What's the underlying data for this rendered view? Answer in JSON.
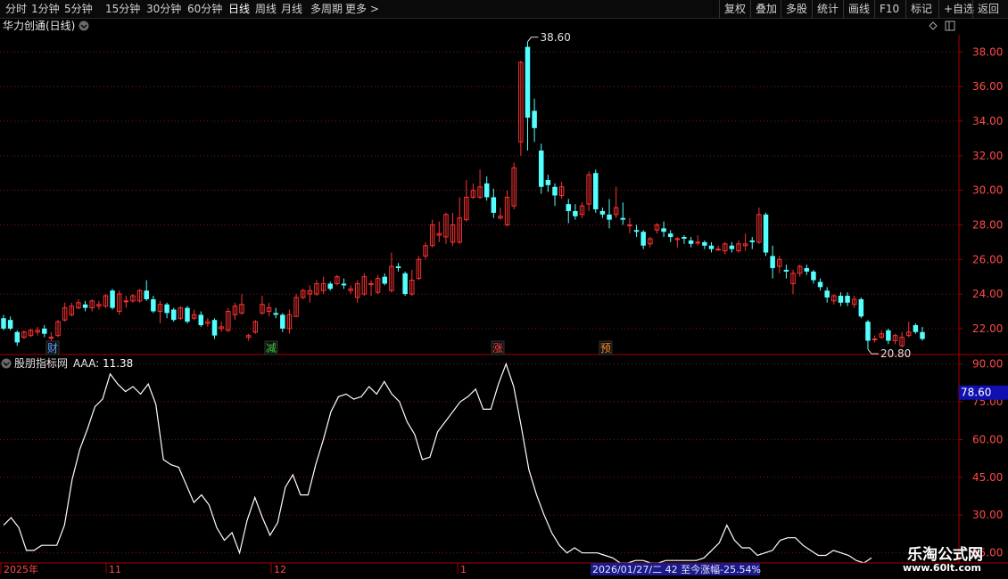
{
  "toolbar": {
    "periods": [
      "分时",
      "1分钟",
      "5分钟",
      "15分钟",
      "30分钟",
      "60分钟",
      "日线",
      "周线",
      "月线",
      "多周期",
      "更多 >"
    ],
    "active_period": "日线",
    "tools": [
      "复权",
      "叠加",
      "多股",
      "统计",
      "画线",
      "F10",
      "标记",
      "+自选",
      "返回"
    ]
  },
  "main_panel": {
    "title": "华力创通(日线)",
    "high_label": "38.60",
    "low_label": "20.80",
    "markers": [
      {
        "text": "财",
        "color": "#5aa0ff"
      },
      {
        "text": "减",
        "color": "#3ccc3c"
      },
      {
        "text": "涨",
        "color": "#ff4040"
      },
      {
        "text": "预",
        "color": "#ff8a28"
      }
    ]
  },
  "indicator_panel": {
    "title": "股朋指标网",
    "value_label": "AAA: 11.38",
    "current_value_badge": "78.60"
  },
  "status_bar": {
    "dates": [
      "2025年",
      "11",
      "12",
      "1"
    ],
    "range_info": "2026/01/27/二 42 至今涨幅-25.54%"
  },
  "watermark": {
    "text": "乐淘公式网",
    "url": "www.60lt.com"
  },
  "colors": {
    "up": "#ff3232",
    "down": "#54ffff",
    "grid": "#7a1a1a",
    "axis": "#aa0000",
    "line": "#ffffff"
  },
  "chart_data": [
    {
      "type": "candlestick",
      "ylim": [
        20.5,
        39.0
      ],
      "yticks": [
        "22.00",
        "24.00",
        "26.00",
        "28.00",
        "30.00",
        "32.00",
        "34.00",
        "36.00",
        "38.00"
      ],
      "candles": [
        [
          22.6,
          22.0,
          22.8,
          21.9
        ],
        [
          22.5,
          22.0,
          22.7,
          21.9
        ],
        [
          21.8,
          21.2,
          21.9,
          21.0
        ],
        [
          21.5,
          21.8,
          21.9,
          21.4
        ],
        [
          21.6,
          21.9,
          22.0,
          21.5
        ],
        [
          21.8,
          21.9,
          22.1,
          21.6
        ],
        [
          22.0,
          21.7,
          22.2,
          21.5
        ],
        [
          21.5,
          21.5,
          21.8,
          21.3
        ],
        [
          21.6,
          22.4,
          22.5,
          21.5
        ],
        [
          22.5,
          23.2,
          23.5,
          22.4
        ],
        [
          22.8,
          23.3,
          23.5,
          22.7
        ],
        [
          23.2,
          23.5,
          23.7,
          23.1
        ],
        [
          23.4,
          23.2,
          23.6,
          23.0
        ],
        [
          23.2,
          23.6,
          23.7,
          23.0
        ],
        [
          23.3,
          23.4,
          23.6,
          23.1
        ],
        [
          23.3,
          23.9,
          24.0,
          23.2
        ],
        [
          24.2,
          23.2,
          24.3,
          23.1
        ],
        [
          23.0,
          24.0,
          24.2,
          22.8
        ],
        [
          23.6,
          23.6,
          23.9,
          23.2
        ],
        [
          23.6,
          23.9,
          24.0,
          23.5
        ],
        [
          23.6,
          24.2,
          24.3,
          23.5
        ],
        [
          24.2,
          23.7,
          24.8,
          23.6
        ],
        [
          23.7,
          23.0,
          23.9,
          22.9
        ],
        [
          23.0,
          23.4,
          23.6,
          22.3
        ],
        [
          23.4,
          22.9,
          23.5,
          22.6
        ],
        [
          23.1,
          22.5,
          23.2,
          22.4
        ],
        [
          22.6,
          23.2,
          23.3,
          22.5
        ],
        [
          23.2,
          22.4,
          23.3,
          22.3
        ],
        [
          22.6,
          22.8,
          23.1,
          22.5
        ],
        [
          22.8,
          22.2,
          23.0,
          22.1
        ],
        [
          22.3,
          22.4,
          22.6,
          22.1
        ],
        [
          22.5,
          21.6,
          22.6,
          21.4
        ],
        [
          22.0,
          22.1,
          22.4,
          21.8
        ],
        [
          21.9,
          23.0,
          23.2,
          21.8
        ],
        [
          22.8,
          23.3,
          23.5,
          22.5
        ],
        [
          22.9,
          23.4,
          24.0,
          22.8
        ],
        [
          21.5,
          21.6,
          21.7,
          21.3
        ],
        [
          21.8,
          22.4,
          22.5,
          21.7
        ],
        [
          22.9,
          23.4,
          23.9,
          22.8
        ],
        [
          23.0,
          23.2,
          23.5,
          22.7
        ],
        [
          22.9,
          22.8,
          23.2,
          22.6
        ],
        [
          22.8,
          22.0,
          22.9,
          21.8
        ],
        [
          22.0,
          22.8,
          23.1,
          21.7
        ],
        [
          22.7,
          23.8,
          24.0,
          22.7
        ],
        [
          23.8,
          24.2,
          24.3,
          23.7
        ],
        [
          24.0,
          24.2,
          24.5,
          23.5
        ],
        [
          24.0,
          24.6,
          24.8,
          23.9
        ],
        [
          24.2,
          24.6,
          25.0,
          24.0
        ],
        [
          24.6,
          24.3,
          24.7,
          24.2
        ],
        [
          24.6,
          25.0,
          25.1,
          24.5
        ],
        [
          24.6,
          24.5,
          24.9,
          24.3
        ],
        [
          24.2,
          24.3,
          24.5,
          24.0
        ],
        [
          23.8,
          24.6,
          24.8,
          23.5
        ],
        [
          24.0,
          25.0,
          25.2,
          23.9
        ],
        [
          24.6,
          24.6,
          24.8,
          23.9
        ],
        [
          24.1,
          24.9,
          25.1,
          24.0
        ],
        [
          25.0,
          24.6,
          25.2,
          24.5
        ],
        [
          24.2,
          25.6,
          26.4,
          24.1
        ],
        [
          25.6,
          25.5,
          25.8,
          25.3
        ],
        [
          25.2,
          24.0,
          25.3,
          23.9
        ],
        [
          24.0,
          24.8,
          25.4,
          23.9
        ],
        [
          24.9,
          26.0,
          26.2,
          24.8
        ],
        [
          26.2,
          26.8,
          27.0,
          26.0
        ],
        [
          26.8,
          28.0,
          28.3,
          26.7
        ],
        [
          27.4,
          27.5,
          28.2,
          27.0
        ],
        [
          27.3,
          28.6,
          28.7,
          26.9
        ],
        [
          27.0,
          28.0,
          28.7,
          26.8
        ],
        [
          27.0,
          28.4,
          29.6,
          26.9
        ],
        [
          28.3,
          29.6,
          30.6,
          28.2
        ],
        [
          29.6,
          30.0,
          30.4,
          29.5
        ],
        [
          29.6,
          30.2,
          31.2,
          29.5
        ],
        [
          30.4,
          29.6,
          30.8,
          29.4
        ],
        [
          29.6,
          28.7,
          30.1,
          28.4
        ],
        [
          28.4,
          28.5,
          29.0,
          28.3
        ],
        [
          28.0,
          29.6,
          30.0,
          27.9
        ],
        [
          29.1,
          31.3,
          31.6,
          28.9
        ],
        [
          32.8,
          37.4,
          37.5,
          32.0
        ],
        [
          38.3,
          34.2,
          38.6,
          32.3
        ],
        [
          34.6,
          33.6,
          35.3,
          32.8
        ],
        [
          32.3,
          30.2,
          32.7,
          29.8
        ],
        [
          30.6,
          30.3,
          30.9,
          29.9
        ],
        [
          30.2,
          29.7,
          30.4,
          29.1
        ],
        [
          29.7,
          30.2,
          30.5,
          29.5
        ],
        [
          29.2,
          28.8,
          29.5,
          28.1
        ],
        [
          28.8,
          28.5,
          29.2,
          28.3
        ],
        [
          28.6,
          29.1,
          29.3,
          28.4
        ],
        [
          29.2,
          30.9,
          31.1,
          28.8
        ],
        [
          31.0,
          28.9,
          31.2,
          28.7
        ],
        [
          28.8,
          28.6,
          29.0,
          28.4
        ],
        [
          28.6,
          28.3,
          29.5,
          27.8
        ],
        [
          28.6,
          29.0,
          30.2,
          28.4
        ],
        [
          28.4,
          28.3,
          29.3,
          28.0
        ],
        [
          28.0,
          28.0,
          28.4,
          27.5
        ],
        [
          27.7,
          27.6,
          28.0,
          27.3
        ],
        [
          27.6,
          26.8,
          27.7,
          26.6
        ],
        [
          26.9,
          27.2,
          27.3,
          26.7
        ],
        [
          27.7,
          28.0,
          28.1,
          27.5
        ],
        [
          27.8,
          27.6,
          28.2,
          27.3
        ],
        [
          27.5,
          27.3,
          27.7,
          27.0
        ],
        [
          27.2,
          27.2,
          27.3,
          26.7
        ],
        [
          27.3,
          27.2,
          27.4,
          26.9
        ],
        [
          27.1,
          26.9,
          27.3,
          26.7
        ],
        [
          27.0,
          27.0,
          27.4,
          26.8
        ],
        [
          27.0,
          26.8,
          27.1,
          26.6
        ],
        [
          26.8,
          26.6,
          27.0,
          26.4
        ],
        [
          26.6,
          26.6,
          26.8,
          26.5
        ],
        [
          26.5,
          26.9,
          27.0,
          26.3
        ],
        [
          26.8,
          26.6,
          27.0,
          26.4
        ],
        [
          26.5,
          26.9,
          27.1,
          26.4
        ],
        [
          26.8,
          26.9,
          27.5,
          26.5
        ],
        [
          27.1,
          27.0,
          27.3,
          26.6
        ],
        [
          27.0,
          28.6,
          29.0,
          26.9
        ],
        [
          28.6,
          26.4,
          28.7,
          26.2
        ],
        [
          26.2,
          25.5,
          26.8,
          24.9
        ],
        [
          25.6,
          26.0,
          26.2,
          25.2
        ],
        [
          25.4,
          25.3,
          25.7,
          24.9
        ],
        [
          24.6,
          25.2,
          25.4,
          24.0
        ],
        [
          25.2,
          25.6,
          25.7,
          25.0
        ],
        [
          25.5,
          25.3,
          25.7,
          25.1
        ],
        [
          25.3,
          24.8,
          25.4,
          24.6
        ],
        [
          24.7,
          24.4,
          24.9,
          24.2
        ],
        [
          24.2,
          23.8,
          24.4,
          23.5
        ],
        [
          23.6,
          23.9,
          24.0,
          23.4
        ],
        [
          23.9,
          23.5,
          24.1,
          23.3
        ],
        [
          23.9,
          23.5,
          24.1,
          23.3
        ],
        [
          23.4,
          23.7,
          23.9,
          23.2
        ],
        [
          23.7,
          22.7,
          23.8,
          22.6
        ],
        [
          22.4,
          21.3,
          22.5,
          20.8
        ],
        [
          21.4,
          21.4,
          21.6,
          21.2
        ],
        [
          21.5,
          21.7,
          21.9,
          21.4
        ],
        [
          21.9,
          21.3,
          22.0,
          21.1
        ],
        [
          21.3,
          21.6,
          21.7,
          21.1
        ],
        [
          21.0,
          21.5,
          21.8,
          20.9
        ],
        [
          21.6,
          21.8,
          22.4,
          21.5
        ],
        [
          22.2,
          21.8,
          22.3,
          21.7
        ],
        [
          21.8,
          21.4,
          22.1,
          21.3
        ]
      ]
    },
    {
      "type": "line",
      "ylim": [
        11.0,
        93.0
      ],
      "yticks": [
        "15.00",
        "30.00",
        "45.00",
        "60.00",
        "75.00",
        "90.00"
      ],
      "values": [
        26,
        29,
        25,
        16,
        16,
        18,
        18,
        18,
        26,
        44,
        56,
        64,
        73,
        76,
        86,
        82,
        79,
        81,
        78,
        82,
        74,
        52,
        50,
        49,
        42,
        35,
        38,
        34,
        25,
        20,
        23,
        15,
        28,
        37,
        29,
        22,
        27,
        41,
        46,
        38,
        38,
        50,
        60,
        71,
        77,
        78,
        76,
        77,
        81,
        78,
        83,
        78,
        75,
        67,
        62,
        52,
        53,
        63,
        67,
        71,
        75,
        77,
        80,
        72,
        72,
        82,
        90,
        81,
        65,
        48,
        38,
        30,
        23,
        18,
        15,
        17,
        15,
        15,
        15,
        14,
        13,
        11,
        11,
        12,
        12,
        11,
        11,
        12,
        12,
        12,
        12,
        12,
        13,
        16,
        19,
        26,
        20,
        17,
        17,
        14,
        15,
        16,
        20,
        21,
        21,
        18,
        16,
        14,
        14,
        16,
        15,
        14,
        12,
        11,
        13
      ]
    }
  ]
}
